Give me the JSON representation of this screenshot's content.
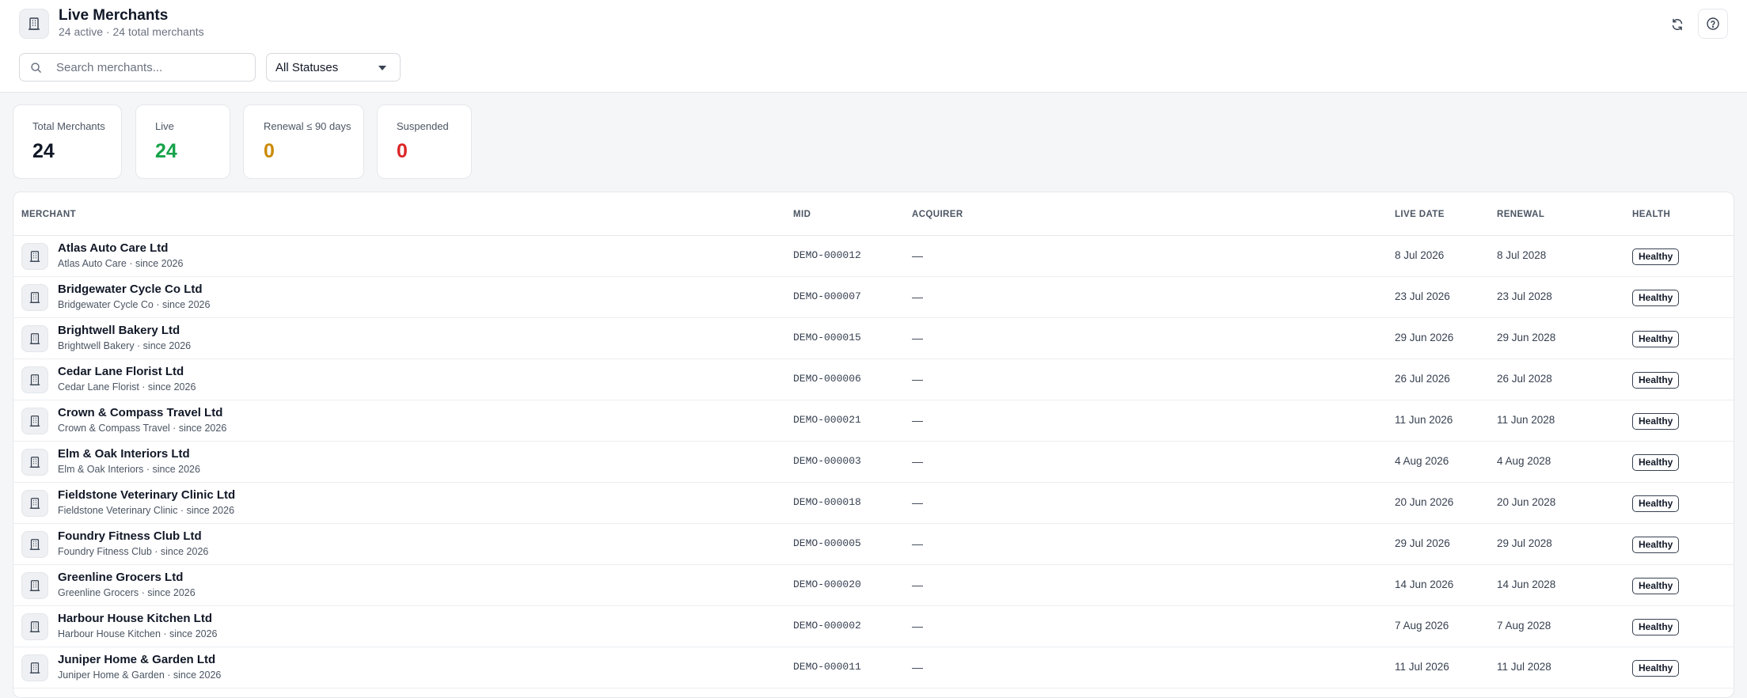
{
  "header": {
    "title": "Live Merchants",
    "subtitle": "24 active · 24 total merchants",
    "icon": "building-icon"
  },
  "filters": {
    "search_placeholder": "Search merchants...",
    "status_value": "All Statuses"
  },
  "stats": [
    {
      "label": "Total Merchants",
      "value": "24",
      "color": "#111827"
    },
    {
      "label": "Live",
      "value": "24",
      "color": "#16a34a"
    },
    {
      "label": "Renewal ≤ 90 days",
      "value": "0",
      "color": "#ca8a04"
    },
    {
      "label": "Suspended",
      "value": "0",
      "color": "#dc2626"
    }
  ],
  "table": {
    "columns": [
      "MERCHANT",
      "MID",
      "ACQUIRER",
      "LIVE DATE",
      "RENEWAL",
      "HEALTH"
    ],
    "rows": [
      {
        "name": "Atlas Auto Care Ltd",
        "sub": "Atlas Auto Care · since 2026",
        "mid": "DEMO-000012",
        "acquirer": "—",
        "live": "8 Jul 2026",
        "renewal": "8 Jul 2028",
        "health": "Healthy"
      },
      {
        "name": "Bridgewater Cycle Co Ltd",
        "sub": "Bridgewater Cycle Co · since 2026",
        "mid": "DEMO-000007",
        "acquirer": "—",
        "live": "23 Jul 2026",
        "renewal": "23 Jul 2028",
        "health": "Healthy"
      },
      {
        "name": "Brightwell Bakery Ltd",
        "sub": "Brightwell Bakery · since 2026",
        "mid": "DEMO-000015",
        "acquirer": "—",
        "live": "29 Jun 2026",
        "renewal": "29 Jun 2028",
        "health": "Healthy"
      },
      {
        "name": "Cedar Lane Florist Ltd",
        "sub": "Cedar Lane Florist · since 2026",
        "mid": "DEMO-000006",
        "acquirer": "—",
        "live": "26 Jul 2026",
        "renewal": "26 Jul 2028",
        "health": "Healthy"
      },
      {
        "name": "Crown & Compass Travel Ltd",
        "sub": "Crown & Compass Travel · since 2026",
        "mid": "DEMO-000021",
        "acquirer": "—",
        "live": "11 Jun 2026",
        "renewal": "11 Jun 2028",
        "health": "Healthy"
      },
      {
        "name": "Elm & Oak Interiors Ltd",
        "sub": "Elm & Oak Interiors · since 2026",
        "mid": "DEMO-000003",
        "acquirer": "—",
        "live": "4 Aug 2026",
        "renewal": "4 Aug 2028",
        "health": "Healthy"
      },
      {
        "name": "Fieldstone Veterinary Clinic Ltd",
        "sub": "Fieldstone Veterinary Clinic · since 2026",
        "mid": "DEMO-000018",
        "acquirer": "—",
        "live": "20 Jun 2026",
        "renewal": "20 Jun 2028",
        "health": "Healthy"
      },
      {
        "name": "Foundry Fitness Club Ltd",
        "sub": "Foundry Fitness Club · since 2026",
        "mid": "DEMO-000005",
        "acquirer": "—",
        "live": "29 Jul 2026",
        "renewal": "29 Jul 2028",
        "health": "Healthy"
      },
      {
        "name": "Greenline Grocers Ltd",
        "sub": "Greenline Grocers · since 2026",
        "mid": "DEMO-000020",
        "acquirer": "—",
        "live": "14 Jun 2026",
        "renewal": "14 Jun 2028",
        "health": "Healthy"
      },
      {
        "name": "Harbour House Kitchen Ltd",
        "sub": "Harbour House Kitchen · since 2026",
        "mid": "DEMO-000002",
        "acquirer": "—",
        "live": "7 Aug 2026",
        "renewal": "7 Aug 2028",
        "health": "Healthy"
      },
      {
        "name": "Juniper Home & Garden Ltd",
        "sub": "Juniper Home & Garden · since 2026",
        "mid": "DEMO-000011",
        "acquirer": "—",
        "live": "11 Jul 2026",
        "renewal": "11 Jul 2028",
        "health": "Healthy"
      }
    ]
  }
}
